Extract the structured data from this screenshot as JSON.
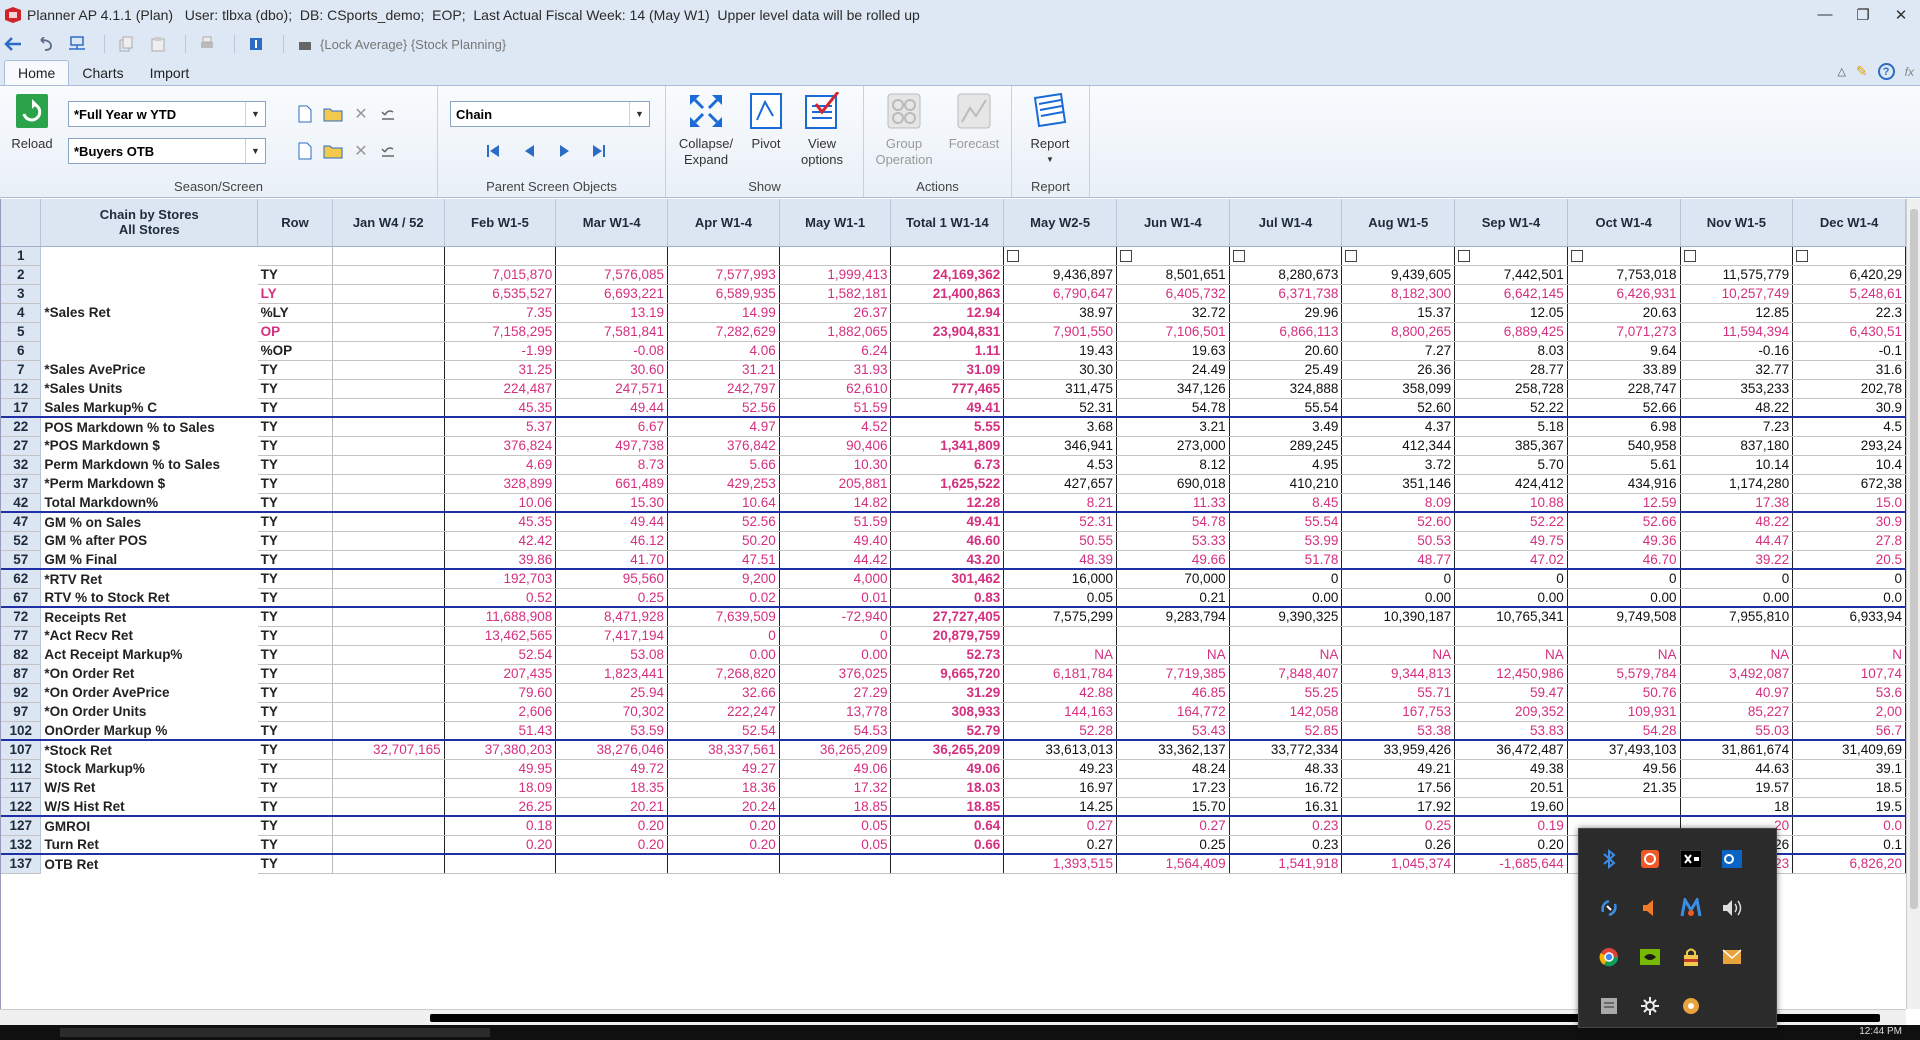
{
  "title": "Planner AP 4.1.1 (Plan)   User: tlbxa (dbo);  DB: CSports_demo;  EOP;  Last Actual Fiscal Week: 14 (May W1)  Upper level data will be rolled up",
  "quick_access": {
    "lock_text": "{Lock Average} {Stock Planning}"
  },
  "tabs": [
    "Home",
    "Charts",
    "Import"
  ],
  "ribbon": {
    "reload": "Reload",
    "season_combo": "*Full Year w YTD",
    "screen_combo": "*Buyers OTB",
    "season_group": "Season/Screen",
    "parent_combo": "Chain",
    "parent_group": "Parent Screen Objects",
    "collapse": "Collapse/",
    "expand": "Expand",
    "pivot": "Pivot",
    "view": "View",
    "options": "options",
    "show_group": "Show",
    "group": "Group",
    "operation": "Operation",
    "forecast": "Forecast",
    "actions_group": "Actions",
    "report": "Report",
    "report_group": "Report"
  },
  "grid": {
    "header_line1": "Chain by Stores",
    "header_line2": "All Stores",
    "row_header": "Row",
    "columns": [
      "Jan W4 / 52",
      "Feb W1-5",
      "Mar W1-4",
      "Apr W1-4",
      "May W1-1",
      "Total 1 W1-14",
      "May W2-5",
      "Jun W1-4",
      "Jul W1-4",
      "Aug W1-5",
      "Sep W1-4",
      "Oct W1-4",
      "Nov W1-5",
      "Dec W1-4"
    ],
    "rows": [
      {
        "n": "1",
        "m": "",
        "r": "",
        "v": [
          "",
          "",
          "",
          "",
          "",
          "",
          "",
          "",
          "",
          "",
          "",
          "",
          "",
          ""
        ],
        "cb": true
      },
      {
        "n": "2",
        "m": "",
        "r": "TY",
        "rc": "bk",
        "v": [
          "",
          "7,015,870",
          "7,576,085",
          "7,577,993",
          "1,999,413",
          "24,169,362",
          "9,436,897",
          "8,501,651",
          "8,280,673",
          "9,439,605",
          "7,442,501",
          "7,753,018",
          "11,575,779",
          "6,420,29"
        ]
      },
      {
        "n": "3",
        "m": "",
        "r": "LY",
        "rc": "pk",
        "v": [
          "",
          "6,535,527",
          "6,693,221",
          "6,589,935",
          "1,582,181",
          "21,400,863",
          "6,790,647",
          "6,405,732",
          "6,371,738",
          "8,182,300",
          "6,642,145",
          "6,426,931",
          "10,257,749",
          "5,248,61"
        ],
        "allpink": true
      },
      {
        "n": "4",
        "m": "*Sales Ret",
        "r": "%LY",
        "rc": "bk",
        "v": [
          "",
          "7.35",
          "13.19",
          "14.99",
          "26.37",
          "12.94",
          "38.97",
          "32.72",
          "29.96",
          "15.37",
          "12.05",
          "20.63",
          "12.85",
          "22.3"
        ]
      },
      {
        "n": "5",
        "m": "",
        "r": "OP",
        "rc": "pk",
        "v": [
          "",
          "7,158,295",
          "7,581,841",
          "7,282,629",
          "1,882,065",
          "23,904,831",
          "7,901,550",
          "7,106,501",
          "6,866,113",
          "8,800,265",
          "6,889,425",
          "7,071,273",
          "11,594,394",
          "6,430,51"
        ],
        "allpink": true
      },
      {
        "n": "6",
        "m": "",
        "r": "%OP",
        "rc": "bk",
        "v": [
          "",
          "-1.99",
          "-0.08",
          "4.06",
          "6.24",
          "1.11",
          "19.43",
          "19.63",
          "20.60",
          "7.27",
          "8.03",
          "9.64",
          "-0.16",
          "-0.1"
        ]
      },
      {
        "n": "7",
        "m": "*Sales AvePrice",
        "r": "TY",
        "rc": "bk",
        "v": [
          "",
          "31.25",
          "30.60",
          "31.21",
          "31.93",
          "31.09",
          "30.30",
          "24.49",
          "25.49",
          "26.36",
          "28.77",
          "33.89",
          "32.77",
          "31.6"
        ]
      },
      {
        "n": "12",
        "m": "*Sales Units",
        "r": "TY",
        "rc": "bk",
        "v": [
          "",
          "224,487",
          "247,571",
          "242,797",
          "62,610",
          "777,465",
          "311,475",
          "347,126",
          "324,888",
          "358,099",
          "258,728",
          "228,747",
          "353,233",
          "202,78"
        ]
      },
      {
        "n": "17",
        "m": "Sales Markup% C",
        "r": "TY",
        "rc": "bk",
        "v": [
          "",
          "45.35",
          "49.44",
          "52.56",
          "51.59",
          "49.41",
          "52.31",
          "54.78",
          "55.54",
          "52.60",
          "52.22",
          "52.66",
          "48.22",
          "30.9"
        ],
        "rule": true
      },
      {
        "n": "22",
        "m": "POS Markdown % to Sales",
        "r": "TY",
        "rc": "bk",
        "v": [
          "",
          "5.37",
          "6.67",
          "4.97",
          "4.52",
          "5.55",
          "3.68",
          "3.21",
          "3.49",
          "4.37",
          "5.18",
          "6.98",
          "7.23",
          "4.5"
        ],
        "mixhalf": true
      },
      {
        "n": "27",
        "m": "*POS Markdown $",
        "r": "TY",
        "rc": "bk",
        "v": [
          "",
          "376,824",
          "497,738",
          "376,842",
          "90,406",
          "1,341,809",
          "346,941",
          "273,000",
          "289,245",
          "412,344",
          "385,367",
          "540,958",
          "837,180",
          "293,24"
        ]
      },
      {
        "n": "32",
        "m": "Perm Markdown % to Sales",
        "r": "TY",
        "rc": "bk",
        "v": [
          "",
          "4.69",
          "8.73",
          "5.66",
          "10.30",
          "6.73",
          "4.53",
          "8.12",
          "4.95",
          "3.72",
          "5.70",
          "5.61",
          "10.14",
          "10.4"
        ]
      },
      {
        "n": "37",
        "m": "*Perm Markdown $",
        "r": "TY",
        "rc": "bk",
        "v": [
          "",
          "328,899",
          "661,489",
          "429,253",
          "205,881",
          "1,625,522",
          "427,657",
          "690,018",
          "410,210",
          "351,146",
          "424,412",
          "434,916",
          "1,174,280",
          "672,38"
        ]
      },
      {
        "n": "42",
        "m": "Total Markdown%",
        "r": "TY",
        "rc": "bk",
        "v": [
          "",
          "10.06",
          "15.30",
          "10.64",
          "14.82",
          "12.28",
          "8.21",
          "11.33",
          "8.45",
          "8.09",
          "10.88",
          "12.59",
          "17.38",
          "15.0"
        ],
        "allpink": true,
        "rule": true
      },
      {
        "n": "47",
        "m": "GM % on Sales",
        "r": "TY",
        "rc": "bk",
        "v": [
          "",
          "45.35",
          "49.44",
          "52.56",
          "51.59",
          "49.41",
          "52.31",
          "54.78",
          "55.54",
          "52.60",
          "52.22",
          "52.66",
          "48.22",
          "30.9"
        ],
        "allpink": true
      },
      {
        "n": "52",
        "m": "GM % after POS",
        "r": "TY",
        "rc": "bk",
        "v": [
          "",
          "42.42",
          "46.12",
          "50.20",
          "49.40",
          "46.60",
          "50.55",
          "53.33",
          "53.99",
          "50.53",
          "49.75",
          "49.36",
          "44.47",
          "27.8"
        ],
        "allpink": true
      },
      {
        "n": "57",
        "m": "GM % Final",
        "r": "TY",
        "rc": "bk",
        "v": [
          "",
          "39.86",
          "41.70",
          "47.51",
          "44.42",
          "43.20",
          "48.39",
          "49.66",
          "51.78",
          "48.77",
          "47.02",
          "46.70",
          "39.22",
          "20.5"
        ],
        "allpink": true,
        "rule": true
      },
      {
        "n": "62",
        "m": "*RTV Ret",
        "r": "TY",
        "rc": "bk",
        "v": [
          "",
          "192,703",
          "95,560",
          "9,200",
          "4,000",
          "301,462",
          "16,000",
          "70,000",
          "0",
          "0",
          "0",
          "0",
          "0",
          "0"
        ]
      },
      {
        "n": "67",
        "m": "RTV % to Stock Ret",
        "r": "TY",
        "rc": "bk",
        "v": [
          "",
          "0.52",
          "0.25",
          "0.02",
          "0.01",
          "0.83",
          "0.05",
          "0.21",
          "0.00",
          "0.00",
          "0.00",
          "0.00",
          "0.00",
          "0.0"
        ],
        "rule": true
      },
      {
        "n": "72",
        "m": "Receipts Ret",
        "r": "TY",
        "rc": "bk",
        "v": [
          "",
          "11,688,908",
          "8,471,928",
          "7,639,509",
          "-72,940",
          "27,727,405",
          "7,575,299",
          "9,283,794",
          "9,390,325",
          "10,390,187",
          "10,765,341",
          "9,749,508",
          "7,955,810",
          "6,933,94"
        ]
      },
      {
        "n": "77",
        "m": "*Act Recv Ret",
        "r": "TY",
        "rc": "bk",
        "v": [
          "",
          "13,462,565",
          "7,417,194",
          "0",
          "0",
          "20,879,759",
          "",
          "",
          "",
          "",
          "",
          "",
          "",
          ""
        ]
      },
      {
        "n": "82",
        "m": "Act Receipt Markup%",
        "r": "TY",
        "rc": "bk",
        "v": [
          "",
          "52.54",
          "53.08",
          "0.00",
          "0.00",
          "52.73",
          "NA",
          "NA",
          "NA",
          "NA",
          "NA",
          "NA",
          "NA",
          "N"
        ],
        "allpink": true
      },
      {
        "n": "87",
        "m": "*On Order Ret",
        "r": "TY",
        "rc": "bk",
        "v": [
          "",
          "207,435",
          "1,823,441",
          "7,268,820",
          "376,025",
          "9,665,720",
          "6,181,784",
          "7,719,385",
          "7,848,407",
          "9,344,813",
          "12,450,986",
          "5,579,784",
          "3,492,087",
          "107,74"
        ],
        "allpink": true
      },
      {
        "n": "92",
        "m": "*On Order AvePrice",
        "r": "TY",
        "rc": "bk",
        "v": [
          "",
          "79.60",
          "25.94",
          "32.66",
          "27.29",
          "31.29",
          "42.88",
          "46.85",
          "55.25",
          "55.71",
          "59.47",
          "50.76",
          "40.97",
          "53.6"
        ],
        "allpink": true
      },
      {
        "n": "97",
        "m": "*On Order Units",
        "r": "TY",
        "rc": "bk",
        "v": [
          "",
          "2,606",
          "70,302",
          "222,247",
          "13,778",
          "308,933",
          "144,163",
          "164,772",
          "142,058",
          "167,753",
          "209,352",
          "109,931",
          "85,227",
          "2,00"
        ],
        "allpink": true
      },
      {
        "n": "102",
        "m": "OnOrder Markup %",
        "r": "TY",
        "rc": "bk",
        "v": [
          "",
          "51.43",
          "53.59",
          "52.54",
          "54.53",
          "52.79",
          "52.28",
          "53.43",
          "52.85",
          "53.38",
          "53.83",
          "54.28",
          "55.03",
          "56.7"
        ],
        "allpink": true,
        "rule": true
      },
      {
        "n": "107",
        "m": "*Stock Ret",
        "r": "TY",
        "rc": "bk",
        "v": [
          "32,707,165",
          "37,380,203",
          "38,276,046",
          "38,337,561",
          "36,265,209",
          "36,265,209",
          "33,613,013",
          "33,362,137",
          "33,772,334",
          "33,959,426",
          "36,472,487",
          "37,493,103",
          "31,861,674",
          "31,409,69"
        ]
      },
      {
        "n": "112",
        "m": "Stock Markup%",
        "r": "TY",
        "rc": "bk",
        "v": [
          "",
          "49.95",
          "49.72",
          "49.27",
          "49.06",
          "49.06",
          "49.23",
          "48.24",
          "48.33",
          "49.21",
          "49.38",
          "49.56",
          "44.63",
          "39.1"
        ]
      },
      {
        "n": "117",
        "m": "W/S Ret",
        "r": "TY",
        "rc": "bk",
        "v": [
          "",
          "18.09",
          "18.35",
          "18.36",
          "17.32",
          "18.03",
          "16.97",
          "17.23",
          "16.72",
          "17.56",
          "20.51",
          "21.35",
          "19.57",
          "18.5"
        ]
      },
      {
        "n": "122",
        "m": "W/S Hist Ret",
        "r": "TY",
        "rc": "bk",
        "v": [
          "",
          "26.25",
          "20.21",
          "20.24",
          "18.85",
          "18.85",
          "14.25",
          "15.70",
          "16.31",
          "17.92",
          "19.60",
          "",
          "18",
          "19.5"
        ],
        "rule": true
      },
      {
        "n": "127",
        "m": "GMROI",
        "r": "TY",
        "rc": "bk",
        "v": [
          "",
          "0.18",
          "0.20",
          "0.20",
          "0.05",
          "0.64",
          "0.27",
          "0.27",
          "0.23",
          "0.25",
          "0.19",
          "",
          "20",
          "0.0"
        ],
        "allpink": true
      },
      {
        "n": "132",
        "m": "Turn Ret",
        "r": "TY",
        "rc": "bk",
        "v": [
          "",
          "0.20",
          "0.20",
          "0.20",
          "0.05",
          "0.66",
          "0.27",
          "0.25",
          "0.23",
          "0.26",
          "0.20",
          "",
          "26",
          "0.1"
        ],
        "rule": true
      },
      {
        "n": "137",
        "m": "OTB Ret",
        "r": "TY",
        "rc": "bk",
        "v": [
          "",
          "",
          "",
          "",
          "",
          "",
          "1,393,515",
          "1,564,409",
          "1,541,918",
          "1,045,374",
          "-1,685,644",
          "",
          "23",
          "6,826,20"
        ],
        "allpink": true
      }
    ]
  },
  "taskbar": {
    "clock": "12:44 PM"
  },
  "tray_icons": [
    "bluetooth-icon",
    "camera-app-icon",
    "x-app-icon",
    "outlook-icon",
    "sync-icon",
    "speaker-muted-icon",
    "m-app-icon",
    "volume-icon",
    "chrome-icon",
    "nvidia-icon",
    "lock-app-icon",
    "mail-icon",
    "notes-icon",
    "settings-icon",
    "package-icon"
  ],
  "colors": {
    "pink": "#d52f7f",
    "header_bg": "#dce6f2",
    "rule_blue": "#1f2fa6",
    "ribbon_bg": "#e9f0f8"
  }
}
